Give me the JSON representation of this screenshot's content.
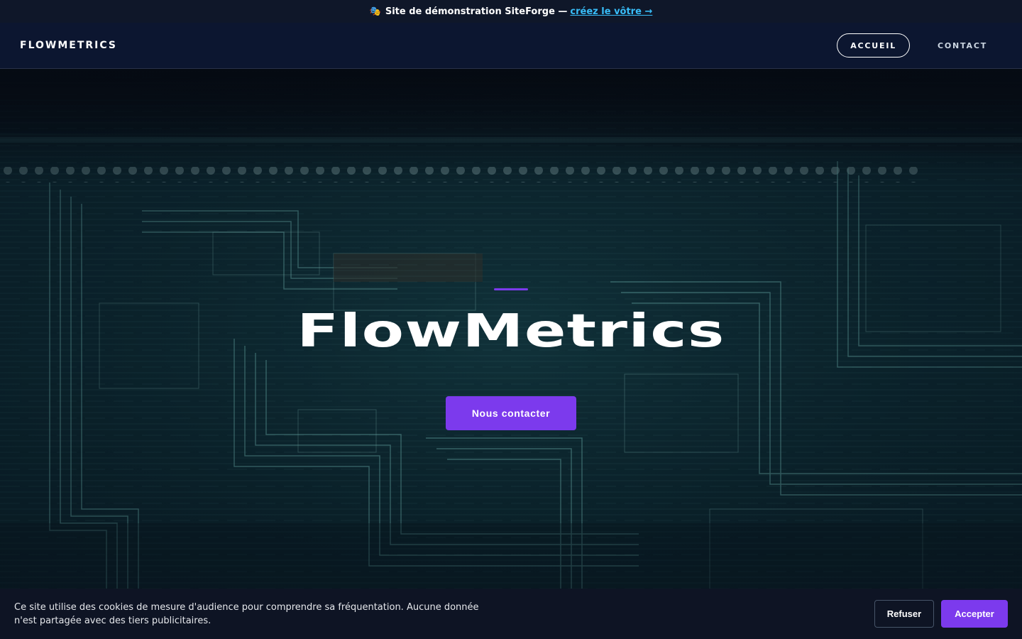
{
  "demo_banner": {
    "emoji": "🎭",
    "text": "Site de démonstration SiteForge —",
    "link_label": "créez le vôtre →"
  },
  "header": {
    "logo": "FLOWMETRICS",
    "nav": [
      {
        "label": "ACCUEIL",
        "active": true
      },
      {
        "label": "CONTACT",
        "active": false
      }
    ]
  },
  "hero": {
    "title": "FlowMetrics",
    "cta_label": "Nous contacter",
    "background": "circuit-board-image"
  },
  "cookie_banner": {
    "text": "Ce site utilise des cookies de mesure d'audience pour comprendre sa fréquentation. Aucune donnée n'est partagée avec des tiers publicitaires.",
    "refuse_label": "Refuser",
    "accept_label": "Accepter"
  },
  "colors": {
    "accent": "#7c3aed",
    "link": "#38bdf8",
    "header_bg": "#0c1630",
    "banner_bg": "#0f1729"
  }
}
